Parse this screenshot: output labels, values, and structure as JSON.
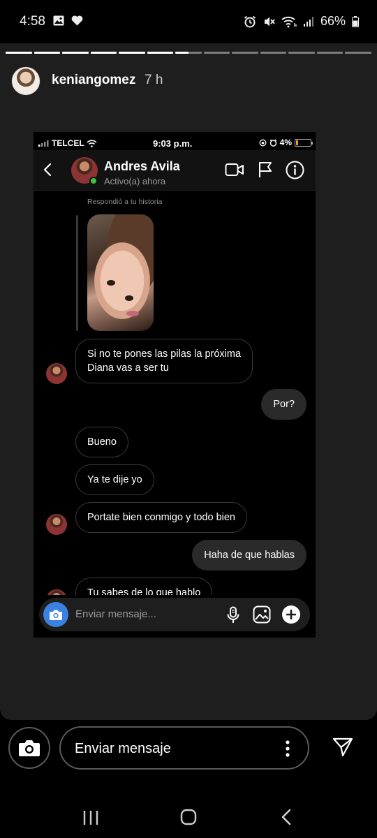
{
  "status_bar": {
    "time": "4:58",
    "battery": "66%",
    "icons": [
      "image-icon",
      "heart-icon",
      "alarm-icon",
      "mute-icon",
      "wifi-icon",
      "signal-icon",
      "battery-icon"
    ]
  },
  "story": {
    "username": "keniangomez",
    "time_ago": "7 h",
    "segments_total": 13,
    "segments_done": 6,
    "current_segment_progress": 0.5
  },
  "inner_status": {
    "carrier": "TELCEL",
    "time": "9:03 p.m.",
    "battery": "4%"
  },
  "chat_header": {
    "name": "Andres Avila",
    "status": "Activo(a) ahora"
  },
  "chat": {
    "reply_label": "Respondió a tu historia",
    "messages": [
      {
        "sender": "them",
        "text": "Si no te pones las pilas la próxima\nDiana vas a ser tu"
      },
      {
        "sender": "me",
        "text": "Por?"
      },
      {
        "sender": "them",
        "text": "Bueno"
      },
      {
        "sender": "them",
        "text": "Ya te dije yo"
      },
      {
        "sender": "them",
        "text": "Portate bien conmigo y todo bien"
      },
      {
        "sender": "me",
        "text": "Haha de que hablas"
      },
      {
        "sender": "them",
        "text": "Tu sabes de lo que hablo"
      }
    ],
    "composer_placeholder": "Enviar mensaje..."
  },
  "reply_bar": {
    "placeholder": "Enviar mensaje"
  },
  "colors": {
    "accent_blue": "#3b82e0",
    "online_green": "#3ec23a",
    "story_bg": "#1e1e1e"
  }
}
